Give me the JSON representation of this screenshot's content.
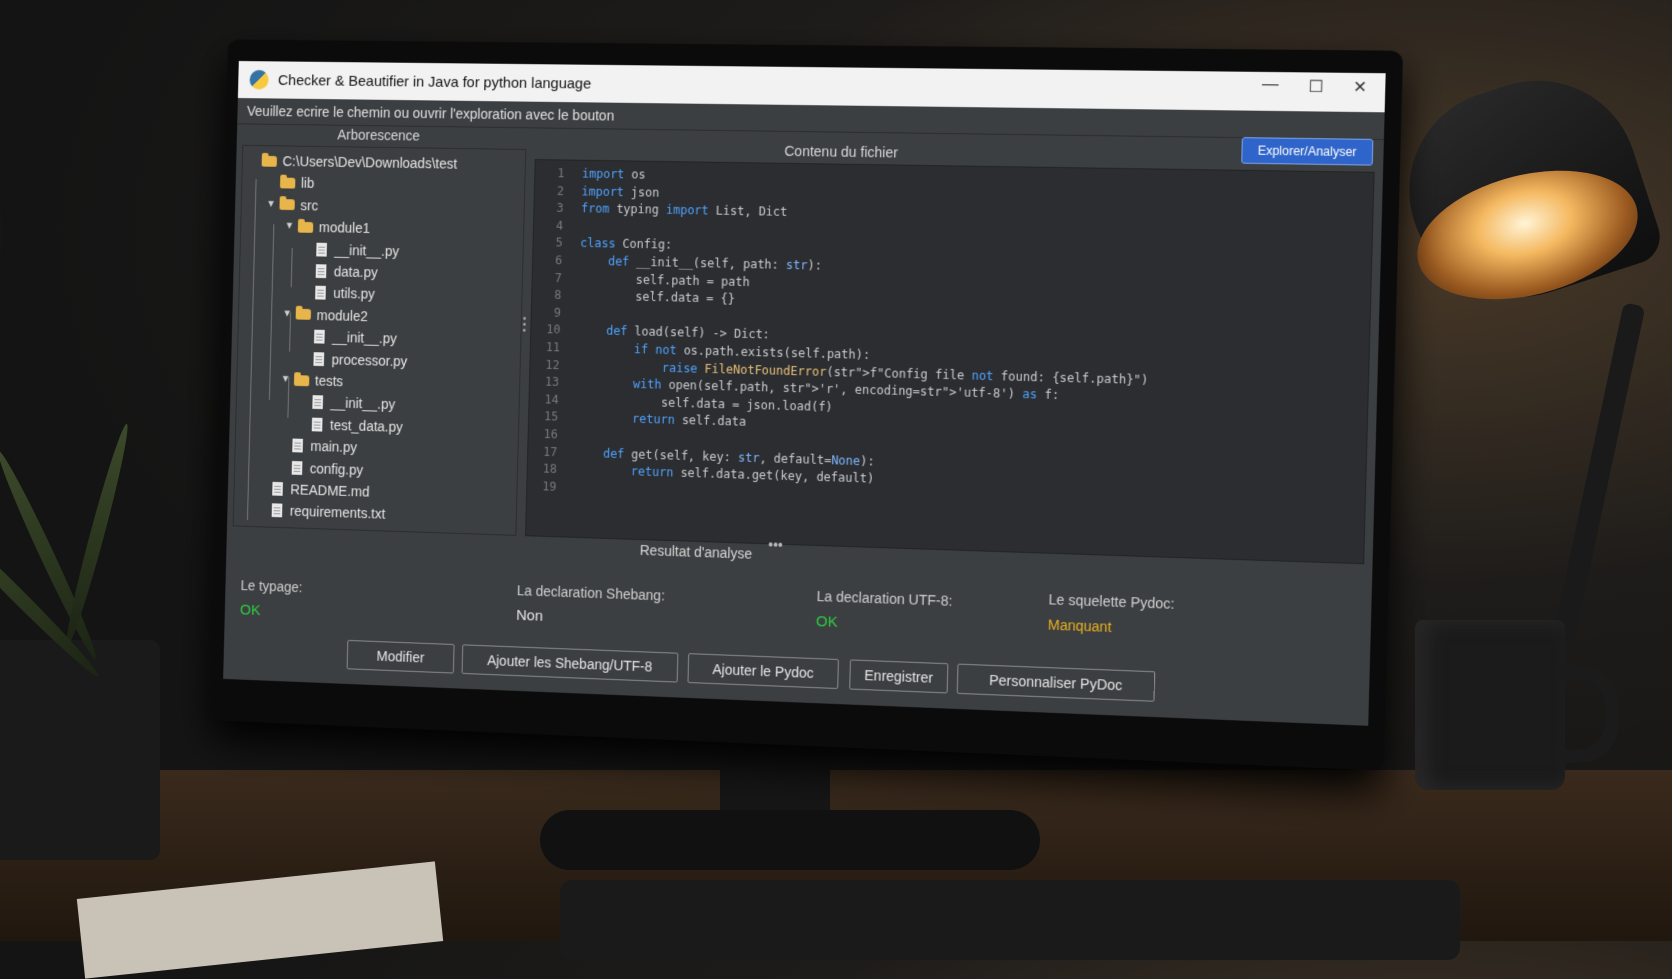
{
  "window": {
    "title": "Checker & Beautifier in Java for python language",
    "controls": {
      "minimize": "—",
      "maximize": "☐",
      "close": "✕"
    }
  },
  "toolbar": {
    "instruction": "Veuillez ecrire le chemin ou ouvrir l'exploration avec le bouton",
    "explore_button": "Explorer/Analyser"
  },
  "tree": {
    "title": "Arborescence",
    "items": [
      {
        "label": "C:\\Users\\Dev\\Downloads\\test",
        "type": "folder",
        "depth": 0,
        "expanded": true
      },
      {
        "label": "lib",
        "type": "folder",
        "depth": 1,
        "expanded": false
      },
      {
        "label": "src",
        "type": "folder",
        "depth": 1,
        "expanded": true
      },
      {
        "label": "module1",
        "type": "folder",
        "depth": 2,
        "expanded": true
      },
      {
        "label": "__init__.py",
        "type": "file",
        "depth": 3
      },
      {
        "label": "data.py",
        "type": "file",
        "depth": 3
      },
      {
        "label": "utils.py",
        "type": "file",
        "depth": 3
      },
      {
        "label": "module2",
        "type": "folder",
        "depth": 2,
        "expanded": true
      },
      {
        "label": "__init__.py",
        "type": "file",
        "depth": 3
      },
      {
        "label": "processor.py",
        "type": "file",
        "depth": 3
      },
      {
        "label": "tests",
        "type": "folder",
        "depth": 2,
        "expanded": true
      },
      {
        "label": "__init__.py",
        "type": "file",
        "depth": 3
      },
      {
        "label": "test_data.py",
        "type": "file",
        "depth": 3
      },
      {
        "label": "main.py",
        "type": "file",
        "depth": 2
      },
      {
        "label": "config.py",
        "type": "file",
        "depth": 2
      },
      {
        "label": "README.md",
        "type": "file",
        "depth": 1
      },
      {
        "label": "requirements.txt",
        "type": "file",
        "depth": 1
      }
    ]
  },
  "editor": {
    "title": "Contenu du fichier",
    "lines": [
      "import os",
      "import json",
      "from typing import List, Dict",
      "",
      "class Config:",
      "    def __init__(self, path: str):",
      "        self.path = path",
      "        self.data = {}",
      "",
      "    def load(self) -> Dict:",
      "        if not os.path.exists(self.path):",
      "            raise FileNotFoundError(f\"Config file not found: {self.path}\")",
      "        with open(self.path, 'r', encoding='utf-8') as f:",
      "            self.data = json.load(f)",
      "        return self.data",
      "",
      "    def get(self, key: str, default=None):",
      "        return self.data.get(key, default)",
      ""
    ]
  },
  "results": {
    "title": "Resultat d'analyse",
    "typage_label": "Le typage:",
    "typage_value": "OK",
    "shebang_label": "La declaration Shebang:",
    "shebang_value": "Non",
    "utf8_label": "La declaration UTF-8:",
    "utf8_value": "OK",
    "pydoc_label": "Le squelette Pydoc:",
    "pydoc_value": "Manquant"
  },
  "actions": {
    "modifier": "Modifier",
    "shebang": "Ajouter les Shebang/UTF-8",
    "pydoc": "Ajouter le Pydoc",
    "save": "Enregistrer",
    "custom_pydoc": "Personnaliser PyDoc"
  }
}
